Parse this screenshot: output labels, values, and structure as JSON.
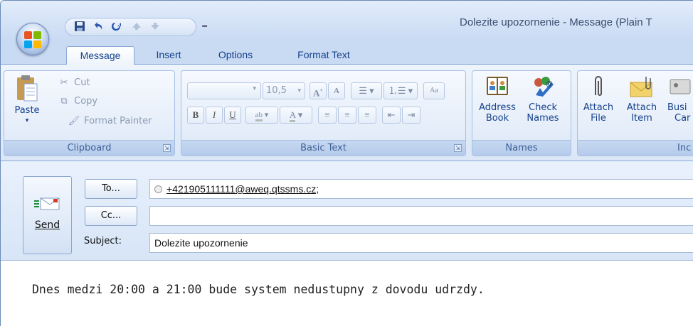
{
  "window": {
    "title": "Dolezite upozornenie - Message (Plain T"
  },
  "quick_access": {
    "icons": [
      "save-icon",
      "undo-icon",
      "redo-icon",
      "previous-item-icon",
      "next-item-icon",
      "customize-dropdown-icon"
    ],
    "dropdown_glyph": "="
  },
  "tabs": [
    {
      "label": "Message",
      "active": true
    },
    {
      "label": "Insert",
      "active": false
    },
    {
      "label": "Options",
      "active": false
    },
    {
      "label": "Format Text",
      "active": false
    }
  ],
  "ribbon": {
    "clipboard": {
      "label": "Clipboard",
      "paste": "Paste",
      "cut": "Cut",
      "copy": "Copy",
      "format_painter": "Format Painter"
    },
    "basic_text": {
      "label": "Basic Text",
      "font_size": "10,5",
      "bold": "B",
      "italic": "I",
      "underline": "U",
      "highlight": "ab",
      "font_color": "A",
      "grow_font": "A",
      "shrink_font": "A"
    },
    "names": {
      "label": "Names",
      "address_book_line1": "Address",
      "address_book_line2": "Book",
      "check_names_line1": "Check",
      "check_names_line2": "Names"
    },
    "include": {
      "label": "Inc",
      "attach_file_line1": "Attach",
      "attach_file_line2": "File",
      "attach_item_line1": "Attach",
      "attach_item_line2": "Item",
      "business_card_line1": "Busi",
      "business_card_line2": "Car"
    }
  },
  "compose": {
    "send_label": "Send",
    "to_button": "To...",
    "cc_button": "Cc...",
    "subject_label": "Subject:",
    "to_value": "+421905111111@aweq.qtssms.cz;",
    "cc_value": "",
    "subject_value": "Dolezite upozornenie",
    "body": "Dnes medzi 20:00 a 21:00 bude system nedustupny z dovodu udrzdy."
  },
  "colors": {
    "ribbon_bg": "#dbe7f7",
    "accent": "#15428b",
    "group_label_bg": "#c6d8f1"
  }
}
